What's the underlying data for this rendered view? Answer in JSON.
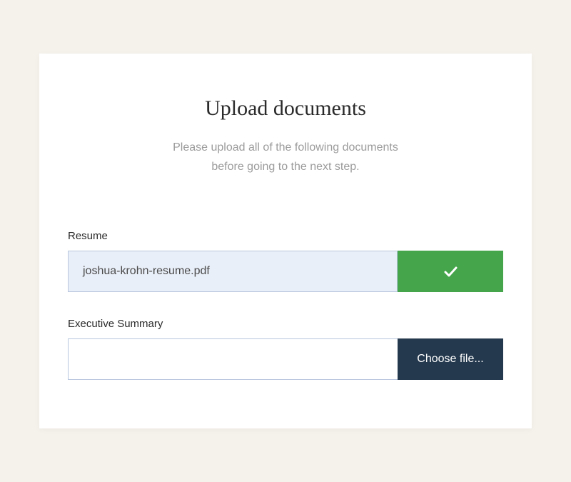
{
  "title": "Upload documents",
  "subtitle_line1": "Please upload all of the following documents",
  "subtitle_line2": "before going to the next step.",
  "fields": {
    "resume": {
      "label": "Resume",
      "filename": "joshua-krohn-resume.pdf"
    },
    "executive_summary": {
      "label": "Executive Summary",
      "filename": "",
      "button_label": "Choose file..."
    }
  },
  "colors": {
    "page_bg": "#f5f1eb",
    "card_bg": "#ffffff",
    "success": "#44a54b",
    "choose_btn": "#24394e",
    "filled_input_bg": "#e9eff8",
    "input_border": "#b8c6de",
    "subtitle_text": "#9b9b9b"
  }
}
